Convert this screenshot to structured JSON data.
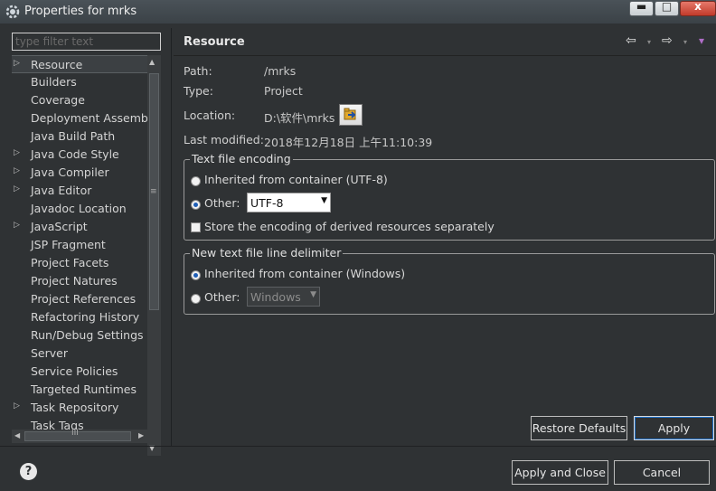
{
  "window": {
    "title": "Properties for mrks",
    "icon": "gear-icon",
    "controls": {
      "minimize": "▬",
      "maximize": "□",
      "close": "x"
    }
  },
  "filter": {
    "placeholder": "type filter text"
  },
  "tree": {
    "items": [
      {
        "label": "Resource",
        "arrow": "▷",
        "selected": true
      },
      {
        "label": "Builders",
        "arrow": ""
      },
      {
        "label": "Coverage",
        "arrow": ""
      },
      {
        "label": "Deployment Assembly",
        "arrow": ""
      },
      {
        "label": "Java Build Path",
        "arrow": ""
      },
      {
        "label": "Java Code Style",
        "arrow": "▷"
      },
      {
        "label": "Java Compiler",
        "arrow": "▷"
      },
      {
        "label": "Java Editor",
        "arrow": "▷"
      },
      {
        "label": "Javadoc Location",
        "arrow": ""
      },
      {
        "label": "JavaScript",
        "arrow": "▷"
      },
      {
        "label": "JSP Fragment",
        "arrow": ""
      },
      {
        "label": "Project Facets",
        "arrow": ""
      },
      {
        "label": "Project Natures",
        "arrow": ""
      },
      {
        "label": "Project References",
        "arrow": ""
      },
      {
        "label": "Refactoring History",
        "arrow": ""
      },
      {
        "label": "Run/Debug Settings",
        "arrow": ""
      },
      {
        "label": "Server",
        "arrow": ""
      },
      {
        "label": "Service Policies",
        "arrow": ""
      },
      {
        "label": "Targeted Runtimes",
        "arrow": ""
      },
      {
        "label": "Task Repository",
        "arrow": "▷"
      },
      {
        "label": "Task Tags",
        "arrow": ""
      }
    ],
    "scroll": {
      "up": "▲",
      "down": "▼",
      "grip": "≡",
      "left": "◀",
      "right": "▶",
      "hgrip": "III"
    }
  },
  "page": {
    "title": "Resource",
    "nav": {
      "back": "⇦",
      "forward": "⇨",
      "menu": "▾",
      "dropdown": "▾"
    },
    "path": {
      "label": "Path:",
      "value": "/mrks"
    },
    "type": {
      "label": "Type:",
      "value": "Project"
    },
    "location": {
      "label": "Location:",
      "value": "D:\\软件\\mrks"
    },
    "modified": {
      "label": "Last modified:",
      "value": "2018年12月18日 上午11:10:39"
    }
  },
  "encoding": {
    "legend": "Text file encoding",
    "inherited": "Inherited from container (UTF-8)",
    "other": "Other:",
    "other_value": "UTF-8",
    "store_derived": "Store the encoding of derived resources separately"
  },
  "line_delimiter": {
    "legend": "New text file line delimiter",
    "inherited": "Inherited from container (Windows)",
    "other": "Other:",
    "other_value": "Windows"
  },
  "buttons": {
    "restore_defaults": "Restore Defaults",
    "apply": "Apply",
    "apply_and_close": "Apply and Close",
    "cancel": "Cancel",
    "help": "?"
  }
}
